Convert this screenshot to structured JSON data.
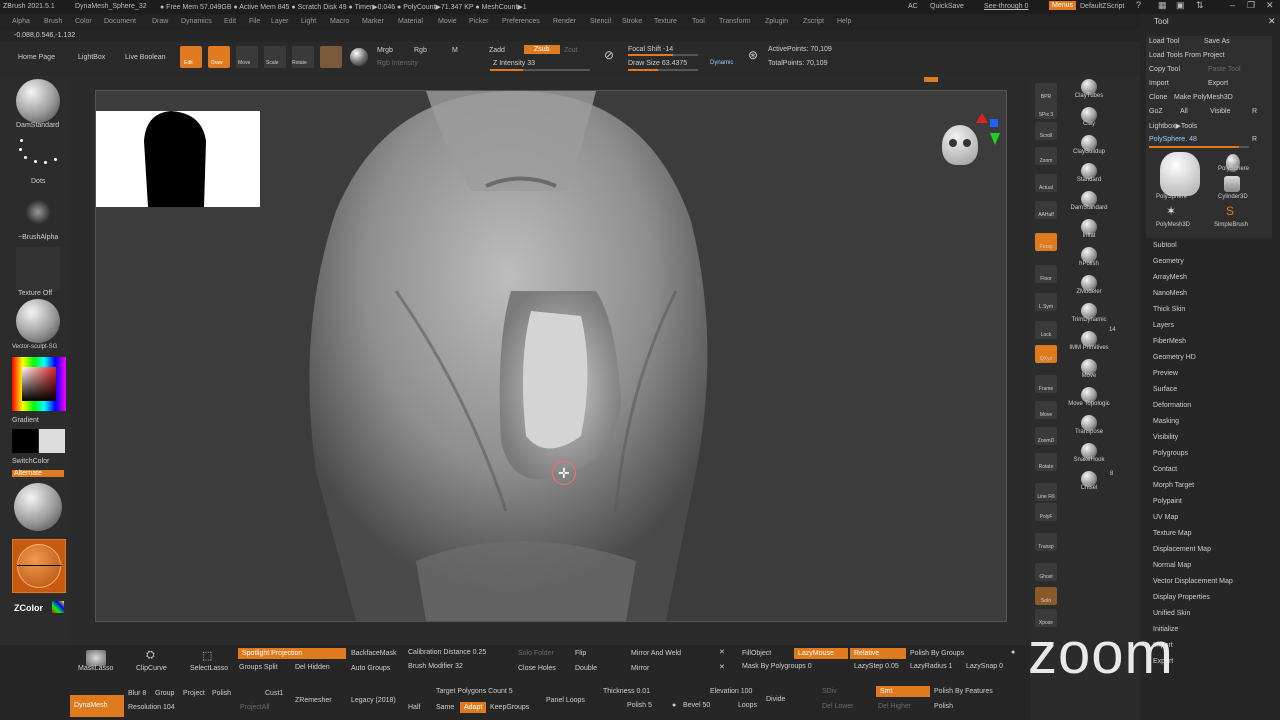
{
  "titlebar": {
    "items": [
      "ZBrush 2021.5.1",
      "DynaMesh_Sphere_32",
      "● Free Mem 57.049GB ● Active Mem 845 ● Scratch Disk 49 ● Timer▶0.046 ● PolyCount▶71.347 KP ● MeshCount▶1"
    ],
    "ac": "AC",
    "quicksave": "QuickSave",
    "seethrough": "See-through  0",
    "menus": "Menus",
    "script": "DefaultZScript"
  },
  "menubar": [
    "Alpha",
    "Brush",
    "Color",
    "Document",
    "Draw",
    "Dynamics",
    "Edit",
    "File",
    "Layer",
    "Light",
    "Macro",
    "Marker",
    "Material",
    "Movie",
    "Picker",
    "Preferences",
    "Render",
    "Stencil",
    "Stroke",
    "Texture",
    "Tool",
    "Transform",
    "Zplugin",
    "Zscript",
    "Help"
  ],
  "coords": "-0.088,0.546,-1.132",
  "toolbar": {
    "home": "Home Page",
    "lightbox": "LightBox",
    "liveboolean": "Live Boolean",
    "edit": "Edit",
    "draw": "Draw",
    "move": "Move",
    "scale": "Scale",
    "rotate": "Rotate",
    "mrgb": "Mrgb",
    "rgb": "Rgb",
    "m": "M",
    "rgb_intensity": "Rgb Intensity",
    "zadd": "Zadd",
    "zsub": "Zsub",
    "zcut": "Zcut",
    "z_intensity": "Z Intensity 33",
    "z_intensity_value": 33,
    "focal_shift": "Focal Shift -14",
    "draw_size": "Draw Size 63.4375",
    "dynamic": "Dynamic",
    "active_points": "ActivePoints: 70,109",
    "total_points": "TotalPoints: 70,109"
  },
  "left_tray": {
    "brush": "DamStandard",
    "stroke": "Dots",
    "alpha": "~BrushAlpha",
    "texture": "Texture Off",
    "material": "Vector-sculpt-SG",
    "gradient": "Gradient",
    "switchcolor": "SwitchColor",
    "alternate": "Alternate",
    "zcolor": "ZColor"
  },
  "right_tray": {
    "buttons": [
      "BPR",
      "SPix 3",
      "Scroll",
      "Zoom",
      "Actual",
      "AAHalf",
      "Persp",
      "Floor",
      "L.Sym",
      "Lock",
      "QXyz",
      "Frame",
      "Move",
      "ZoomD",
      "Rotate",
      "Line Fill",
      "PolyF",
      "Transp",
      "Ghost",
      "Solo",
      "Xpose"
    ],
    "brushes": [
      "ClayTubes",
      "Clay",
      "ClayBuildup",
      "Standard",
      "DamStandard",
      "Inflat",
      "hPolish",
      "ZModeler",
      "TrimDynamic",
      "IMM Primitives",
      "Move",
      "Move Topologic",
      "Transpose",
      "SnakeHook",
      "Chisel"
    ],
    "imm_count": "14",
    "chisel_count": "8"
  },
  "tool_panel": {
    "title": "Tool",
    "load_tool": "Load Tool",
    "save_as": "Save As",
    "load_from_project": "Load Tools From Project",
    "copy_tool": "Copy Tool",
    "paste_tool": "Paste Tool",
    "import": "Import",
    "export": "Export",
    "clone": "Clone",
    "make_polymesh": "Make PolyMesh3D",
    "goz": "GoZ",
    "all": "All",
    "visible": "Visible",
    "r": "R",
    "lightbox_tools": "Lightbox▶Tools",
    "polysphere_slider": "PolySphere. 48",
    "thumbs": [
      "PolySphere",
      "PolySphere",
      "Cylinder3D",
      "PolyMesh3D",
      "SimpleBrush"
    ],
    "sections": [
      "Subtool",
      "Geometry",
      "ArrayMesh",
      "NanoMesh",
      "Thick Skin",
      "Layers",
      "FiberMesh",
      "Geometry HD",
      "Preview",
      "Surface",
      "Deformation",
      "Masking",
      "Visibility",
      "Polygroups",
      "Contact",
      "Morph Target",
      "Polypaint",
      "UV Map",
      "Texture Map",
      "Displacement Map",
      "Normal Map",
      "Vector Displacement Map",
      "Display Properties",
      "Unified Skin",
      "Initialize",
      "Import",
      "Export"
    ]
  },
  "bottom": {
    "masklasso": "MaskLasso",
    "clipcurve": "ClipCurve",
    "selectlasso": "SelectLasso",
    "spotlight": "Spotlight Projection",
    "backfacemask": "BackfaceMask",
    "calibration": "Calibration Distance 0.25",
    "solo_folder": "Solo Folder",
    "flip": "Flip",
    "mirror_weld": "Mirror And Weld",
    "fillobject": "FillObject",
    "lazymouse": "LazyMouse",
    "relative": "Relative",
    "polish_groups": "Polish By Groups",
    "groups_split": "Groups Split",
    "del_hidden": "Del Hidden",
    "auto_groups": "Auto Groups",
    "brush_modifier": "Brush Modifier 32",
    "close_holes": "Close Holes",
    "double": "Double",
    "mirror": "Mirror",
    "mask_polygroups": "Mask By Polygroups 0",
    "lazystep": "LazyStep 0.05",
    "lazyradius": "LazyRadius 1",
    "lazysnap": "LazySnap 0",
    "dynamesh": "DynaMesh",
    "blur": "Blur 8",
    "group": "Group",
    "project": "Project",
    "polish": "Polish",
    "resolution": "Resolution 104",
    "projectall": "ProjectAll",
    "zremesher": "ZRemesher",
    "legacy": "Legacy (2018)",
    "cust1": "Cust1",
    "target_polys": "Target Polygons Count 5",
    "half": "Half",
    "same": "Same",
    "adapt": "Adapt",
    "keepgroups": "KeepGroups",
    "panel_loops": "Panel Loops",
    "thickness": "Thickness 0.01",
    "polish5": "Polish 5",
    "bevel": "Bevel 50",
    "elevation": "Elevation 100",
    "loops": "Loops",
    "divide": "Divide",
    "sdiv": "SDiv",
    "smt": "Smt",
    "polish_features": "Polish By Features",
    "del_lower": "Del Lower",
    "del_higher": "Del Higher",
    "polish_b": "Polish"
  },
  "zoom_logo": "zoom"
}
